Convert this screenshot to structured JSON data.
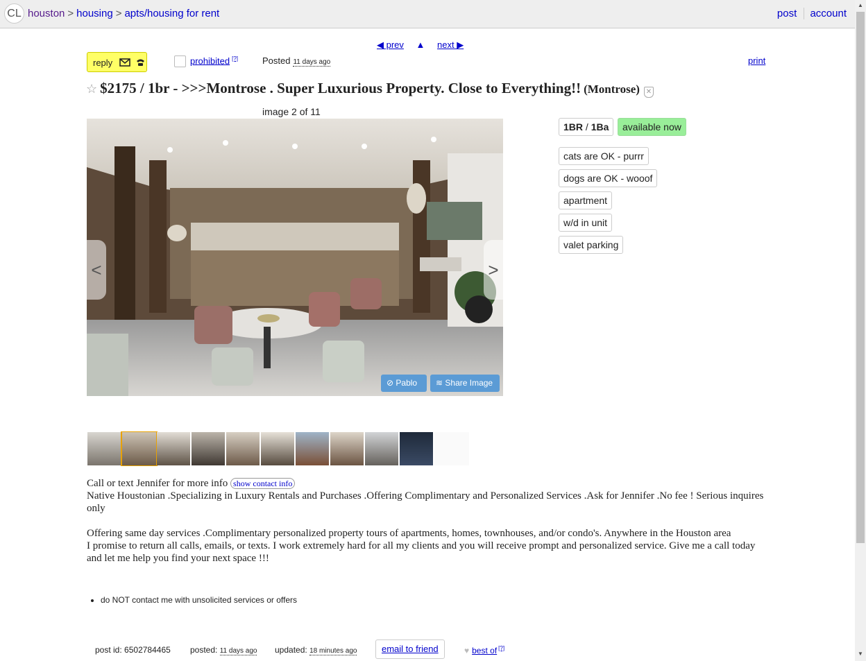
{
  "header": {
    "logo": "CL",
    "breadcrumbs": [
      "houston",
      "housing",
      "apts/housing for rent"
    ],
    "separator": ">",
    "post_label": "post",
    "account_label": "account"
  },
  "nav": {
    "prev_label": "◀ prev",
    "up_label": "▲",
    "next_label": "next ▶"
  },
  "actions": {
    "reply_label": "reply",
    "prohibited_label": "prohibited",
    "prohibited_help": "[?]",
    "posted_label": "Posted",
    "posted_ago": "11 days ago",
    "print_label": "print"
  },
  "posting": {
    "title": "$2175 / 1br - >>>Montrose . Super Luxurious Property. Close to Everything!!",
    "neighborhood": "(Montrose)"
  },
  "gallery": {
    "counter": "image 2 of 11",
    "prev_arrow": "<",
    "next_arrow": ">",
    "pablo_label": "Pablo",
    "share_label": "Share Image",
    "thumbnail_count": 11,
    "selected_index": 1
  },
  "attributes": {
    "br": "1BR",
    "ba": "1Ba",
    "availability": "available now",
    "tags": [
      "cats are OK - purrr",
      "dogs are OK - wooof",
      "apartment",
      "w/d in unit",
      "valet parking"
    ]
  },
  "body": {
    "line1": "Call or text Jennifer for more info",
    "contact_btn": "show contact info",
    "line2": "Native Houstonian .Specializing in Luxury Rentals and Purchases .Offering Complimentary and Personalized Services .Ask for Jennifer .No fee ! Serious inquires only",
    "line3": "Offering same day services .Complimentary personalized property tours of apartments, homes, townhouses, and/or condo's. Anywhere in the Houston area",
    "line4": "I promise to return all calls, emails, or texts. I work extremely hard for all my clients and you will receive prompt and personalized service. Give me a call today and let me help you find your next space !!!"
  },
  "notices": [
    "do NOT contact me with unsolicited services or offers"
  ],
  "footer": {
    "post_id_label": "post id:",
    "post_id": "6502784465",
    "posted_label": "posted:",
    "posted_ago": "11 days ago",
    "updated_label": "updated:",
    "updated_ago": "18 minutes ago",
    "email_friend": "email to friend",
    "best_of": "best of",
    "best_of_help": "[?]"
  }
}
